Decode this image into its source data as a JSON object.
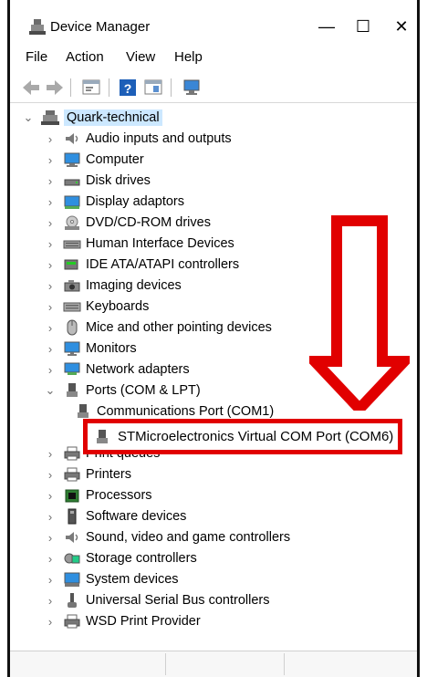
{
  "window": {
    "title": "Device Manager",
    "minimize": "—",
    "maximize": "☐",
    "close": "✕"
  },
  "menu": [
    "File",
    "Action",
    "View",
    "Help"
  ],
  "tree": {
    "root": "Quark-technical",
    "items": [
      {
        "label": "Audio inputs and outputs",
        "icon": "speaker-icon"
      },
      {
        "label": "Computer",
        "icon": "computer-icon"
      },
      {
        "label": "Disk drives",
        "icon": "disk-drive-icon"
      },
      {
        "label": "Display adaptors",
        "icon": "display-adapter-icon"
      },
      {
        "label": "DVD/CD-ROM drives",
        "icon": "dvd-drive-icon"
      },
      {
        "label": "Human Interface Devices",
        "icon": "hid-icon"
      },
      {
        "label": "IDE ATA/ATAPI controllers",
        "icon": "ide-controller-icon"
      },
      {
        "label": "Imaging devices",
        "icon": "camera-icon"
      },
      {
        "label": "Keyboards",
        "icon": "keyboard-icon"
      },
      {
        "label": "Mice and other pointing devices",
        "icon": "mouse-icon"
      },
      {
        "label": "Monitors",
        "icon": "monitor-icon"
      },
      {
        "label": "Network adapters",
        "icon": "network-adapter-icon"
      },
      {
        "label": "Ports (COM & LPT)",
        "icon": "port-icon",
        "expanded": true
      },
      {
        "label": "Communications Port (COM1)",
        "icon": "port-icon",
        "child": true
      },
      {
        "label": "STMicroelectronics Virtual COM Port (COM6)",
        "icon": "port-icon",
        "child": true,
        "highlighted": true
      },
      {
        "label": "Print queues",
        "icon": "printer-icon"
      },
      {
        "label": "Printers",
        "icon": "printer-icon"
      },
      {
        "label": "Processors",
        "icon": "processor-icon"
      },
      {
        "label": "Software devices",
        "icon": "software-device-icon"
      },
      {
        "label": "Sound, video and game controllers",
        "icon": "speaker-icon"
      },
      {
        "label": "Storage controllers",
        "icon": "storage-controller-icon"
      },
      {
        "label": "System devices",
        "icon": "system-device-icon"
      },
      {
        "label": "Universal Serial Bus controllers",
        "icon": "usb-icon"
      },
      {
        "label": "WSD Print Provider",
        "icon": "printer-icon"
      }
    ]
  },
  "colors": {
    "highlight": "#e10000",
    "selection": "#cce8ff"
  }
}
